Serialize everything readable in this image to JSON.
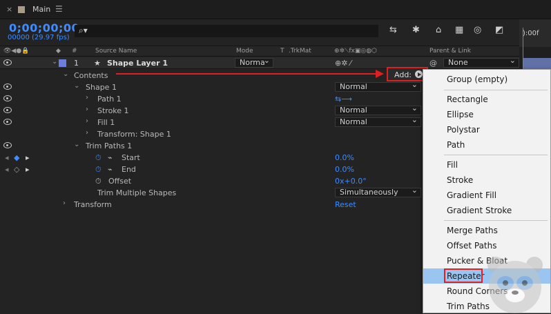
{
  "tab": {
    "title": "Main"
  },
  "timecode": {
    "value": "0;00;00;00",
    "fps": "00000 (29.97 fps)"
  },
  "header": {
    "hash": "#",
    "source_name": "Source Name",
    "mode": "Mode",
    "t": "T",
    "trkmat": ".TrkMat",
    "parent_link": "Parent & Link"
  },
  "ruler": {
    "label": "):00f"
  },
  "layer": {
    "number": "1",
    "name": "Shape Layer 1",
    "mode": "Norma",
    "parent": "None"
  },
  "rows": {
    "contents": "Contents",
    "add_label": "Add:",
    "shape1": "Shape 1",
    "shape1_mode": "Normal",
    "path1": "Path 1",
    "stroke1": "Stroke 1",
    "stroke1_mode": "Normal",
    "fill1": "Fill 1",
    "fill1_mode": "Normal",
    "transform_shape1": "Transform: Shape 1",
    "trim_paths1": "Trim Paths 1",
    "start": "Start",
    "start_val": "0.0%",
    "end": "End",
    "end_val": "0.0%",
    "offset": "Offset",
    "offset_val": "0x+0.0°",
    "trim_multiple": "Trim Multiple Shapes",
    "trim_multiple_val": "Simultaneously",
    "transform": "Transform",
    "reset": "Reset"
  },
  "menu": {
    "items": [
      "Group (empty)",
      "Rectangle",
      "Ellipse",
      "Polystar",
      "Path",
      "Fill",
      "Stroke",
      "Gradient Fill",
      "Gradient Stroke",
      "Merge Paths",
      "Offset Paths",
      "Pucker & Bloat",
      "Repeater",
      "Round Corners",
      "Trim Paths"
    ],
    "highlighted": "Repeater"
  },
  "colors": {
    "accent": "#3e8cff",
    "highlight": "#e02020",
    "layer_label": "#6b7ee0"
  }
}
